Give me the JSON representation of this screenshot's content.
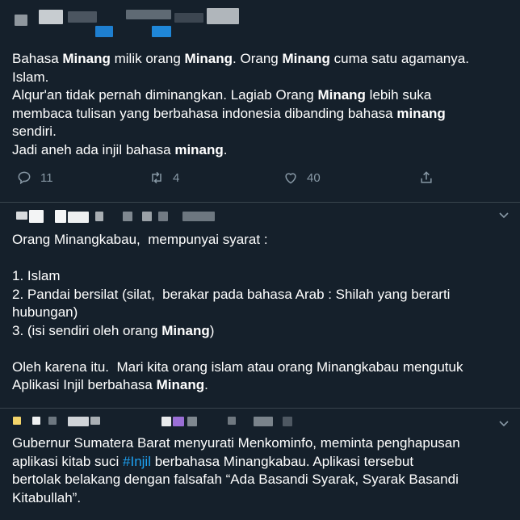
{
  "colors": {
    "background": "#15202b",
    "text": "#ffffff",
    "muted": "#8899a6",
    "link": "#1da1f2",
    "divider": "#38444d"
  },
  "tweet1": {
    "lines": [
      [
        {
          "t": "Bahasa "
        },
        {
          "t": "Minang",
          "b": true
        },
        {
          "t": " milik orang "
        },
        {
          "t": "Minang",
          "b": true
        },
        {
          "t": ". Orang "
        },
        {
          "t": "Minang",
          "b": true
        },
        {
          "t": " cuma satu agamanya."
        }
      ],
      [
        {
          "t": "Islam."
        }
      ],
      [
        {
          "t": "Alqur'an tidak pernah diminangkan. Lagiab Orang "
        },
        {
          "t": "Minang",
          "b": true
        },
        {
          "t": " lebih suka"
        }
      ],
      [
        {
          "t": "membaca tulisan yang berbahasa indonesia dibanding bahasa "
        },
        {
          "t": "minang",
          "b": true
        }
      ],
      [
        {
          "t": "sendiri."
        }
      ],
      [
        {
          "t": "Jadi aneh ada injil bahasa "
        },
        {
          "t": "minang",
          "b": true
        },
        {
          "t": "."
        }
      ]
    ],
    "actions": {
      "reply_count": "11",
      "retweet_count": "4",
      "like_count": "40"
    }
  },
  "tweet2": {
    "lines": [
      [
        {
          "t": "Orang Minangkabau,  mempunyai syarat :"
        }
      ],
      [
        {
          "t": ""
        }
      ],
      [
        {
          "t": "1. Islam"
        }
      ],
      [
        {
          "t": "2. Pandai bersilat (silat,  berakar pada bahasa Arab : Shilah yang berarti"
        }
      ],
      [
        {
          "t": "hubungan)"
        }
      ],
      [
        {
          "t": "3. (isi sendiri oleh orang "
        },
        {
          "t": "Minang",
          "b": true
        },
        {
          "t": ")"
        }
      ],
      [
        {
          "t": ""
        }
      ],
      [
        {
          "t": "Oleh karena itu.  Mari kita orang islam atau orang Minangkabau mengutuk"
        }
      ],
      [
        {
          "t": "Aplikasi Injil berbahasa "
        },
        {
          "t": "Minang",
          "b": true
        },
        {
          "t": "."
        }
      ]
    ]
  },
  "tweet3": {
    "lines": [
      [
        {
          "t": "Gubernur Sumatera Barat menyurati Menkominfo, meminta penghapusan"
        }
      ],
      [
        {
          "t": "aplikasi kitab suci "
        },
        {
          "t": "#Injil",
          "h": true
        },
        {
          "t": " berbahasa Minangkabau. Aplikasi tersebut"
        }
      ],
      [
        {
          "t": "bertolak belakang dengan falsafah “Ada Basandi Syarak, Syarak Basandi"
        }
      ],
      [
        {
          "t": "Kitabullah”."
        }
      ]
    ]
  }
}
